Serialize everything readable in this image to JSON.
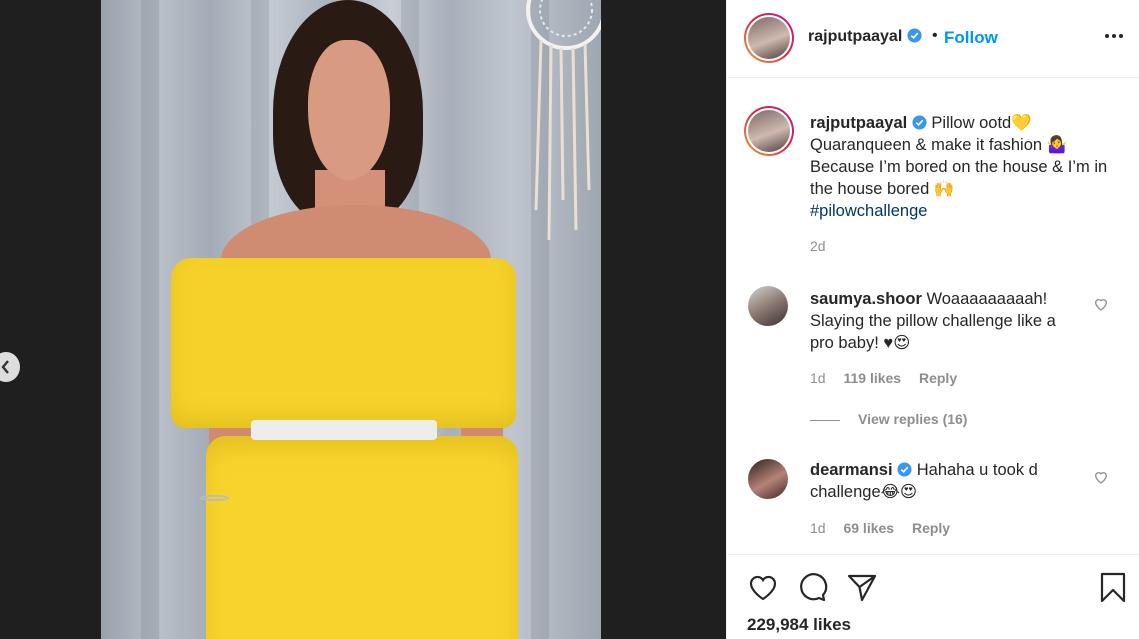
{
  "post": {
    "username": "rajputpaayal",
    "follow_label": "Follow",
    "dot": "•",
    "caption": {
      "line1": "Pillow ootd💛",
      "line2": "Quaranqueen & make it fashion 🤷‍♀️",
      "line3": "Because I’m bored on the house & I’m in the house bored 🙌",
      "hashtag": "#pilowchallenge",
      "age": "2d"
    },
    "likes": "229,984 likes"
  },
  "comments": [
    {
      "username": "saumya.shoor",
      "text": "Woaaaaaaaaah! Slaying the pillow challenge like a pro baby! ♥😍",
      "age": "1d",
      "likes": "119 likes",
      "reply_label": "Reply"
    },
    {
      "username": "dearmansi",
      "text": "Hahaha u took d challenge😂😍",
      "age": "1d",
      "likes": "69 likes",
      "reply_label": "Reply"
    }
  ],
  "view_replies": "View replies (16)",
  "colors": {
    "accent": "#0095f6",
    "hashtag": "#00376b",
    "muted": "#8e8e8e",
    "pillow": "#f5d22a"
  },
  "icons": [
    "chevron-left-icon",
    "verified-icon",
    "more-icon",
    "heart-icon",
    "comment-icon",
    "share-icon",
    "bookmark-icon"
  ]
}
